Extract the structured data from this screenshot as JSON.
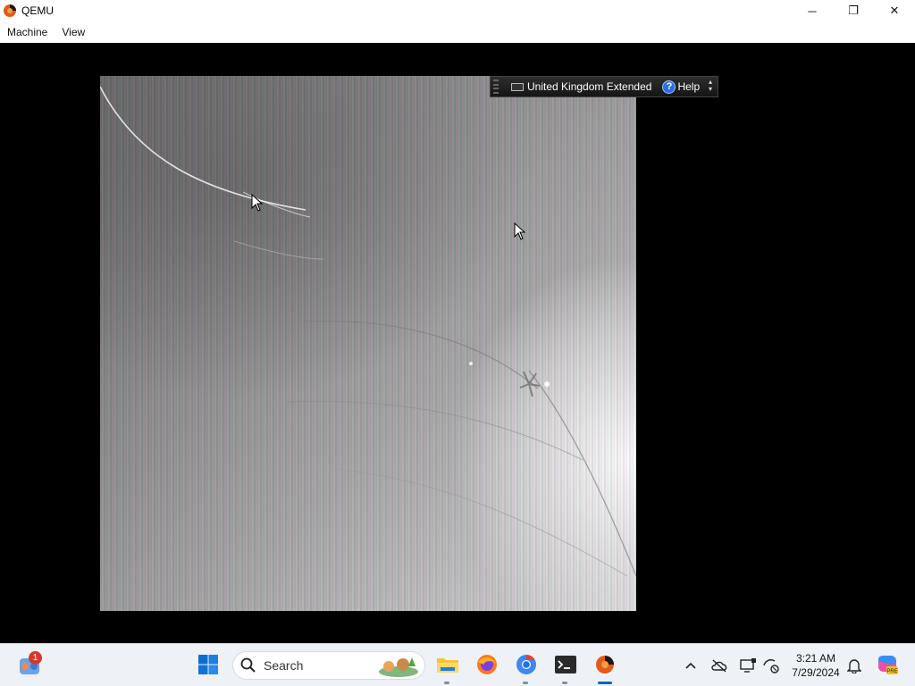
{
  "window": {
    "title": "QEMU",
    "controls": {
      "minimize": "─",
      "maximize": "❐",
      "close": "✕"
    }
  },
  "menu": {
    "items": [
      "Machine",
      "View"
    ]
  },
  "guest": {
    "langbar": {
      "language": "United Kingdom Extended",
      "help_label": "Help",
      "help_glyph": "?"
    }
  },
  "taskbar": {
    "widgets_badge": "1",
    "search": {
      "placeholder": "Search"
    },
    "apps": [
      "start-icon",
      "file-explorer-icon",
      "firefox-icon",
      "chrome-icon",
      "terminal-icon",
      "qemu-icon"
    ]
  },
  "tray": {
    "time": "3:21 AM",
    "date": "7/29/2024",
    "icons": [
      "chevron-up-icon",
      "onedrive-offline-icon",
      "display-icon",
      "network-icon",
      "bell-icon",
      "copilot-icon"
    ]
  },
  "colors": {
    "accent": "#0a5fd6",
    "taskbar_bg": "#eef2f6",
    "badge": "#d23a2a"
  }
}
